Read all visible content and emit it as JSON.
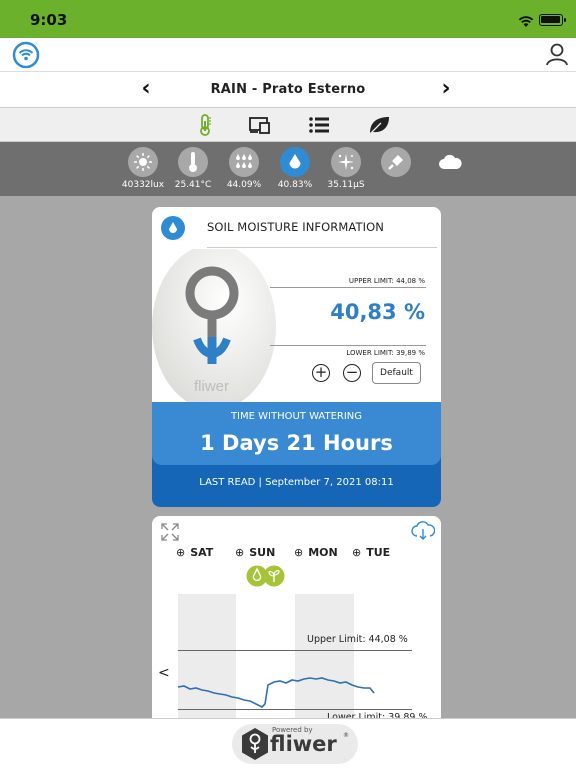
{
  "status": {
    "time": "9:03"
  },
  "title": {
    "text": "RAIN - Prato Esterno",
    "prev": "‹",
    "next": "›"
  },
  "tabs": [
    {
      "name": "thermometer-tab",
      "icon": "thermometer-icon",
      "active": true
    },
    {
      "name": "devices-tab",
      "icon": "devices-icon",
      "active": false
    },
    {
      "name": "list-tab",
      "icon": "list-icon",
      "active": false
    },
    {
      "name": "leaf-tab",
      "icon": "leaf-icon",
      "active": false
    }
  ],
  "sensors": [
    {
      "icon": "sun-icon",
      "value": "40332lux"
    },
    {
      "icon": "thermometer-icon",
      "value": "25.41°C"
    },
    {
      "icon": "humidity-drops-icon",
      "value": "44.09%"
    },
    {
      "icon": "soil-moisture-drop-icon",
      "value": "40.83%",
      "active": true
    },
    {
      "icon": "fertilizer-sparkle-icon",
      "value": "35.11µS"
    },
    {
      "icon": "shovel-icon",
      "value": ""
    },
    {
      "icon": "cloud-icon",
      "value": ""
    }
  ],
  "soil_card": {
    "heading": "SOIL MOISTURE INFORMATION",
    "device_label": "fliwer",
    "upper_limit": "UPPER LIMIT: 44,08 %",
    "value": "40,83 %",
    "lower_limit": "LOWER LIMIT: 39,89 %",
    "plus": "+",
    "minus": "−",
    "default_label": "Default",
    "time_without_watering_label": "TIME WITHOUT WATERING",
    "time_without_watering": "1 Days  21 Hours",
    "last_read": "LAST READ | September 7, 2021 08:11"
  },
  "graph_card": {
    "days": [
      {
        "mag": "⊕",
        "label": "SAT"
      },
      {
        "mag": "⊕",
        "label": "SUN"
      },
      {
        "mag": "⊕",
        "label": "MON"
      },
      {
        "mag": "⊕",
        "label": "TUE"
      }
    ],
    "back": "<",
    "upper_limit_label": "Upper Limit: 44,08 %",
    "lower_limit_label": "Lower Limit: 39,89 %"
  },
  "footer": {
    "powered_by": "Powered by",
    "brand": "fliwer",
    "registered": "®"
  },
  "colors": {
    "status_green": "#6cb12c",
    "accent_blue": "#2e8bd4",
    "dark_blue": "#1666b8",
    "lime": "#a6c437"
  }
}
